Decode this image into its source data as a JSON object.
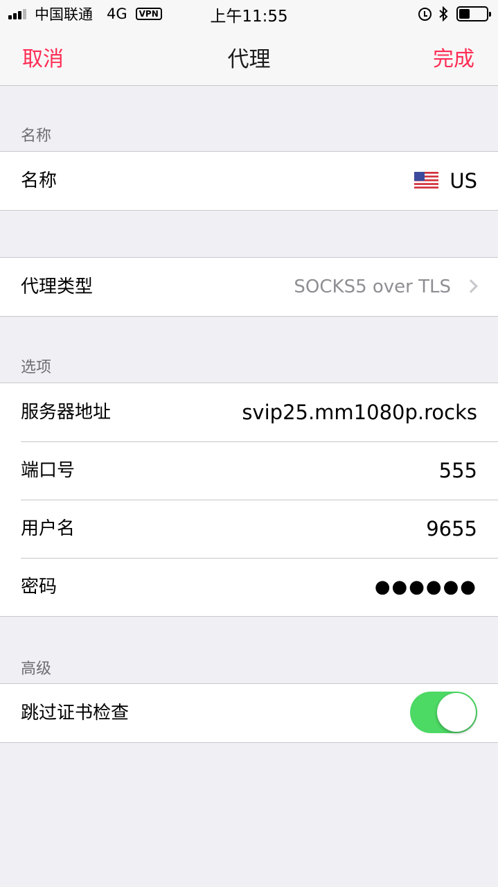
{
  "status_bar": {
    "carrier": "中国联通",
    "network": "4G",
    "vpn": "VPN",
    "time": "上午11:55",
    "icons": [
      "signal-icon",
      "alarm-icon",
      "bluetooth-icon",
      "battery-icon"
    ]
  },
  "nav": {
    "cancel": "取消",
    "title": "代理",
    "done": "完成",
    "accent_color": "#ff2d55"
  },
  "name_section": {
    "header": "名称",
    "label": "名称",
    "value": "US",
    "flag": "us-flag-icon"
  },
  "type_section": {
    "label": "代理类型",
    "value": "SOCKS5 over TLS"
  },
  "options_section": {
    "header": "选项",
    "rows": [
      {
        "label": "服务器地址",
        "value": "svip25.mm1080p.rocks"
      },
      {
        "label": "端口号",
        "value": "555"
      },
      {
        "label": "用户名",
        "value": "9655"
      },
      {
        "label": "密码",
        "value": "●●●●●●"
      }
    ]
  },
  "advanced_section": {
    "header": "高级",
    "label": "跳过证书检查",
    "toggle_on": true,
    "toggle_color": "#4cd964"
  }
}
